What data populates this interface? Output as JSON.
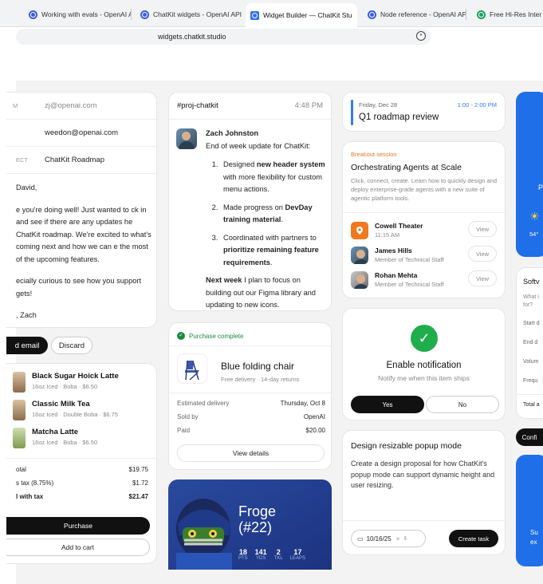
{
  "browser": {
    "tabs": [
      {
        "title": "Working with evals - OpenAI API"
      },
      {
        "title": "ChatKit widgets - OpenAI API"
      },
      {
        "title": "Widget Builder — ChatKit Stu"
      },
      {
        "title": "Node reference - OpenAI API"
      },
      {
        "title": "Free Hi-Res Inter"
      }
    ],
    "url": "widgets.chatkit.studio"
  },
  "email": {
    "from_value": "zj@openai.com",
    "to_value": "weedon@openai.com",
    "subject_label": "ECT",
    "subject_value": "ChatKit Roadmap",
    "greeting": "David,",
    "body_p1": "e you're doing well! Just wanted to ck in and see if there are any updates he ChatKit roadmap. We're excited to what's coming next and how we can e the most of the upcoming features.",
    "body_p2": "ecially curious to see how you support gets!",
    "signoff": ", Zach",
    "send_label": "d email",
    "discard_label": "Discard"
  },
  "order": {
    "items": [
      {
        "name": "Black Sugar Hoick Latte",
        "sub": "16oz Iced · Boba · $6.50"
      },
      {
        "name": "Classic Milk Tea",
        "sub": "16oz Iced · Double Boba · $6.75"
      },
      {
        "name": "Matcha Latte",
        "sub": "16oz Iced · Boba · $6.50"
      }
    ],
    "subtotal_label": "otal",
    "subtotal_value": "$19.75",
    "tax_label": "s tax (8.75%)",
    "tax_value": "$1.72",
    "total_label": "l with tax",
    "total_value": "$21.47",
    "purchase_label": "Purchase",
    "cart_label": "Add to cart"
  },
  "chat": {
    "channel": "#proj-chatkit",
    "time": "4:48 PM",
    "author": "Zach Johnston",
    "intro": "End of week update for ChatKit:",
    "item1_pre": "Designed ",
    "item1_bold": "new header system",
    "item1_post": " with more flexibility for custom menu actions.",
    "item2_pre": "Made progress on ",
    "item2_bold": "DevDay training material",
    "item2_post": ".",
    "item3_pre": "Coordinated with partners to ",
    "item3_bold": "prioritize remaining feature requirements",
    "item3_post": ".",
    "next_bold": "Next week",
    "next_post": " I plan to focus on building out our Figma library and updating to new icons."
  },
  "purchase": {
    "status": "Purchase complete",
    "product": "Blue folding chair",
    "delivery": "Free delivery · 14-day returns",
    "est_label": "Estimated delivery",
    "est_value": "Thursday, Oct 8",
    "sold_label": "Sold by",
    "sold_value": "OpenAI",
    "paid_label": "Paid",
    "paid_value": "$20.00",
    "details_label": "View details"
  },
  "player": {
    "name": "Froge",
    "number": "(#22)",
    "stats": [
      {
        "value": "18",
        "label": "PTS"
      },
      {
        "value": "141",
        "label": "YDS"
      },
      {
        "value": "2",
        "label": "TKL"
      },
      {
        "value": "17",
        "label": "LEAPS"
      }
    ]
  },
  "calendar": {
    "date": "Friday, Dec 28",
    "time": "1:00 - 2:00 PM",
    "title": "Q1 roadmap review"
  },
  "session": {
    "tag": "Breakout session",
    "title": "Orchestrating Agents at Scale",
    "desc": "Click, connect, create. Learn how to quickly design and deploy enterprise-grade agents with a new suite of agentic platform tools.",
    "rows": [
      {
        "name": "Cowell Theater",
        "sub": "11:15 AM"
      },
      {
        "name": "James Hills",
        "sub": "Member of Technical Staff"
      },
      {
        "name": "Rohan Mehta",
        "sub": "Member of Technical Staff"
      }
    ],
    "view_label": "View"
  },
  "notify": {
    "title": "Enable notification",
    "sub": "Notify me when this item ships",
    "yes": "Yes",
    "no": "No"
  },
  "task": {
    "title": "Design resizable popup mode",
    "desc": "Create a design proposal for how ChatKit's popup mode can support dynamic height and user resizing.",
    "date": "10/16/25",
    "create_label": "Create task"
  },
  "right": {
    "weather_p": "P",
    "weather_temp": "54°",
    "soft_title": "Softv",
    "soft_q": "What i for?",
    "soft_rows": [
      "Start d",
      "End d",
      "Volum",
      "Frequ"
    ],
    "soft_total": "Total a",
    "confirm": "Confi",
    "bottom_text": "Su ex"
  }
}
